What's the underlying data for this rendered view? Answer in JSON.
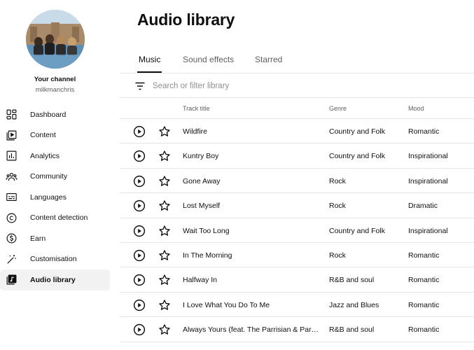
{
  "channel": {
    "label": "Your channel",
    "handle": "milkmanchris"
  },
  "sidebar": {
    "items": [
      {
        "label": "Dashboard",
        "icon": "dashboard-icon",
        "active": false
      },
      {
        "label": "Content",
        "icon": "content-icon",
        "active": false
      },
      {
        "label": "Analytics",
        "icon": "analytics-icon",
        "active": false
      },
      {
        "label": "Community",
        "icon": "community-icon",
        "active": false
      },
      {
        "label": "Languages",
        "icon": "languages-icon",
        "active": false
      },
      {
        "label": "Content detection",
        "icon": "copyright-icon",
        "active": false
      },
      {
        "label": "Earn",
        "icon": "dollar-icon",
        "active": false
      },
      {
        "label": "Customisation",
        "icon": "magic-wand-icon",
        "active": false
      },
      {
        "label": "Audio library",
        "icon": "audio-library-icon",
        "active": true
      }
    ]
  },
  "main": {
    "title": "Audio library",
    "tabs": [
      {
        "label": "Music",
        "active": true
      },
      {
        "label": "Sound effects",
        "active": false
      },
      {
        "label": "Starred",
        "active": false
      }
    ],
    "filter": {
      "placeholder": "Search or filter library",
      "value": ""
    },
    "columns": {
      "title": "Track title",
      "genre": "Genre",
      "mood": "Mood"
    },
    "tracks": [
      {
        "title": "Wildfire",
        "genre": "Country and Folk",
        "mood": "Romantic"
      },
      {
        "title": "Kuntry Boy",
        "genre": "Country and Folk",
        "mood": "Inspirational"
      },
      {
        "title": "Gone Away",
        "genre": "Rock",
        "mood": "Inspirational"
      },
      {
        "title": "Lost Myself",
        "genre": "Rock",
        "mood": "Dramatic"
      },
      {
        "title": "Wait Too Long",
        "genre": "Country and Folk",
        "mood": "Inspirational"
      },
      {
        "title": "In The Morning",
        "genre": "Rock",
        "mood": "Romantic"
      },
      {
        "title": "Halfway In",
        "genre": "R&B and soul",
        "mood": "Romantic"
      },
      {
        "title": "I Love What You Do To Me",
        "genre": "Jazz and Blues",
        "mood": "Romantic"
      },
      {
        "title": "Always Yours (feat. The Parrisian & Parr...",
        "genre": "R&B and soul",
        "mood": "Romantic"
      }
    ]
  }
}
